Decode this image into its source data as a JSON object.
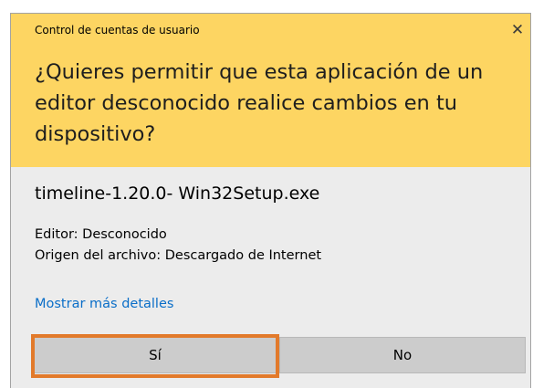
{
  "window": {
    "title": "Control de cuentas de usuario",
    "close_glyph": "✕",
    "close_icon": "close-icon"
  },
  "prompt": {
    "question": "¿Quieres permitir que esta aplicación de un editor desconocido realice cambios en tu dispositivo?"
  },
  "app": {
    "name": "timeline-1.20.0- Win32Setup.exe",
    "publisher": "Editor: Desconocido",
    "origin": "Origen del archivo: Descargado de Internet"
  },
  "links": {
    "more_details": "Mostrar más detalles"
  },
  "buttons": {
    "yes": "Sí",
    "no": "No"
  },
  "colors": {
    "header_bg": "#fdd562",
    "body_bg": "#ececec",
    "button_bg": "#cccccc",
    "link": "#0a6ec8",
    "highlight": "#e27a2b"
  }
}
